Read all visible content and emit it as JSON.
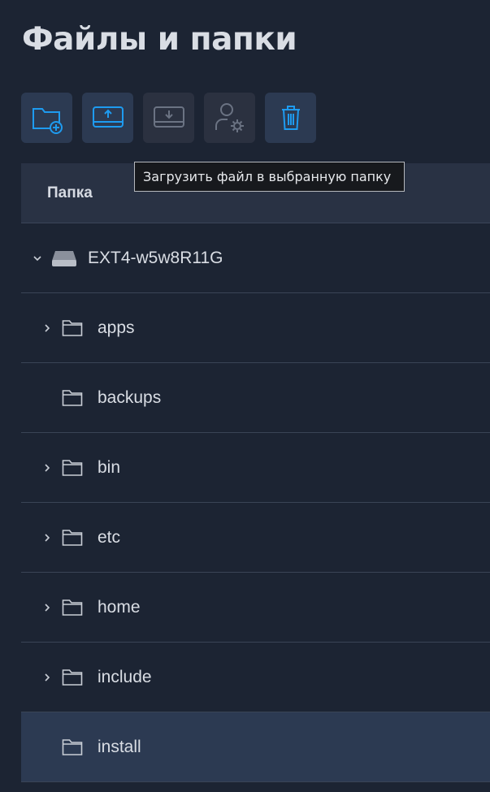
{
  "page": {
    "title": "Файлы и папки"
  },
  "toolbar": {
    "buttons": [
      {
        "name": "create-folder-button",
        "icon": "folder-plus-icon",
        "enabled": true
      },
      {
        "name": "upload-file-button",
        "icon": "drive-upload-icon",
        "enabled": true
      },
      {
        "name": "download-file-button",
        "icon": "drive-download-icon",
        "enabled": false
      },
      {
        "name": "permissions-button",
        "icon": "user-gear-icon",
        "enabled": false
      },
      {
        "name": "delete-button",
        "icon": "trash-icon",
        "enabled": true
      }
    ],
    "tooltip": "Загрузить файл в выбранную папку"
  },
  "table": {
    "header": "Папка",
    "drive": {
      "label": "EXT4-w5w8R11G",
      "icon": "drive-icon",
      "expanded": true
    },
    "rows": [
      {
        "label": "apps",
        "has_children": true,
        "selected": false
      },
      {
        "label": "backups",
        "has_children": false,
        "selected": false
      },
      {
        "label": "bin",
        "has_children": true,
        "selected": false
      },
      {
        "label": "etc",
        "has_children": true,
        "selected": false
      },
      {
        "label": "home",
        "has_children": true,
        "selected": false
      },
      {
        "label": "include",
        "has_children": true,
        "selected": false
      },
      {
        "label": "install",
        "has_children": false,
        "selected": true
      }
    ]
  },
  "colors": {
    "background": "#1c2433",
    "accent": "#1e9bf0",
    "selected_row": "#2c3a52",
    "disabled_icon": "#6b7383"
  }
}
